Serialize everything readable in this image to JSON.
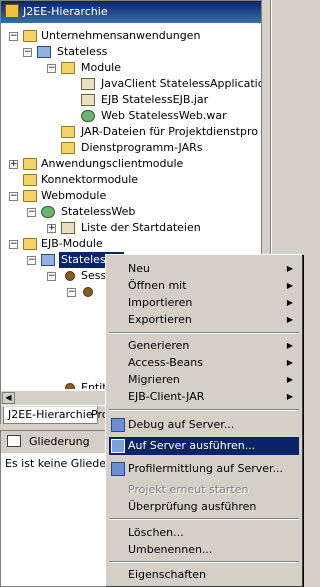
{
  "view": {
    "title": "J2EE-Hierarchie",
    "tree": [
      {
        "id": "t1",
        "label": "Unternehmensanwendungen",
        "expanded": true
      },
      {
        "id": "t2",
        "label": "Stateless",
        "expanded": true
      },
      {
        "id": "t3",
        "label": "Module",
        "expanded": true
      },
      {
        "id": "t4",
        "label": "JavaClient StatelessApplicatio"
      },
      {
        "id": "t5",
        "label": "EJB StatelessEJB.jar"
      },
      {
        "id": "t6",
        "label": "Web StatelessWeb.war"
      },
      {
        "id": "t7",
        "label": "JAR-Dateien für Projektdienstpro"
      },
      {
        "id": "t8",
        "label": "Dienstprogramm-JARs"
      },
      {
        "id": "t9",
        "label": "Anwendungsclientmodule",
        "expanded": false
      },
      {
        "id": "t10",
        "label": "Konnektormodule"
      },
      {
        "id": "t11",
        "label": "Webmodule",
        "expanded": true
      },
      {
        "id": "t12",
        "label": "StatelessWeb",
        "expanded": true
      },
      {
        "id": "t13",
        "label": "Liste der Startdateien",
        "expanded": false
      },
      {
        "id": "t14",
        "label": "EJB-Module",
        "expanded": true
      },
      {
        "id": "t15",
        "label": "Stateless...",
        "expanded": true
      },
      {
        "id": "t16",
        "label": "Sess...",
        "expanded": true
      },
      {
        "id": "t17",
        "label": "Entit..."
      }
    ],
    "tabs": [
      "J2EE-Hierarchie",
      "Pro"
    ]
  },
  "outline": {
    "title": "Gliederung",
    "message": "Es ist keine Gliederung"
  },
  "menu": {
    "items": [
      {
        "label": "Neu",
        "submenu": true
      },
      {
        "label": "Öffnen mit",
        "submenu": true
      },
      {
        "label": "Importieren",
        "submenu": true
      },
      {
        "label": "Exportieren",
        "submenu": true
      },
      {
        "label": "Generieren",
        "submenu": true
      },
      {
        "label": "Access-Beans",
        "submenu": true
      },
      {
        "label": "Migrieren",
        "submenu": true
      },
      {
        "label": "EJB-Client-JAR",
        "submenu": true
      },
      {
        "label": "Debug auf Server...",
        "icon": "debug-server-icon"
      },
      {
        "label": "Auf Server ausführen...",
        "icon": "run-server-icon",
        "highlighted": true
      },
      {
        "label": "Profilermittlung auf Server...",
        "icon": "profile-server-icon"
      },
      {
        "label": "Projekt erneut starten",
        "disabled": true
      },
      {
        "label": "Überprüfung ausführen"
      },
      {
        "label": "Löschen..."
      },
      {
        "label": "Umbenennen..."
      },
      {
        "label": "Eigenschaften"
      }
    ]
  },
  "colors": {
    "selection": "#0a246a",
    "titlebar": "#0a246a",
    "background": "#d4d0c8"
  }
}
